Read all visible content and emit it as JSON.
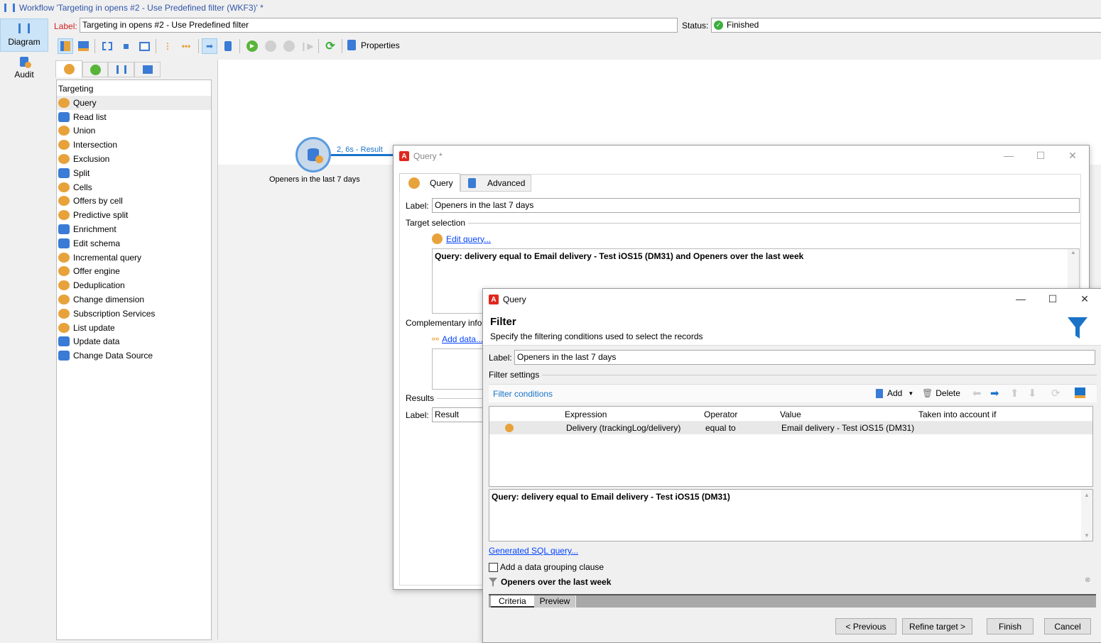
{
  "window": {
    "title": "Workflow 'Targeting in opens #2 - Use Predefined filter (WKF3)' *"
  },
  "nav": [
    {
      "label": "Diagram",
      "icon": "diagram-icon"
    },
    {
      "label": "Audit",
      "icon": "audit-icon"
    }
  ],
  "header": {
    "label_caption": "Label:",
    "label_value": "Targeting in opens #2 - Use Predefined filter",
    "status_caption": "Status:",
    "status_value": "Finished"
  },
  "toolbar": {
    "properties_label": "Properties"
  },
  "palette": {
    "category": "Targeting",
    "items": [
      "Query",
      "Read list",
      "Union",
      "Intersection",
      "Exclusion",
      "Split",
      "Cells",
      "Offers by cell",
      "Predictive split",
      "Enrichment",
      "Edit schema",
      "Incremental query",
      "Offer engine",
      "Deduplication",
      "Change dimension",
      "Subscription Services",
      "List update",
      "Update data",
      "Change Data Source"
    ]
  },
  "canvas": {
    "node_label": "Openers in the last 7 days",
    "transition_label": "2, 6s - Result"
  },
  "query_dialog": {
    "title": "Query *",
    "tabs": [
      "Query",
      "Advanced"
    ],
    "label_caption": "Label:",
    "label_value": "Openers in the last 7 days",
    "target_selection": "Target selection",
    "edit_query": "Edit query...",
    "query_text": "Query: delivery equal to Email delivery - Test iOS15 (DM31) and Openers over the last week",
    "complementary": "Complementary info",
    "add_data": "Add data...",
    "results": "Results",
    "result_label_caption": "Label:",
    "result_label_value": "Result"
  },
  "filter_dialog": {
    "title": "Query",
    "heading": "Filter",
    "subtitle": "Specify the filtering conditions used to select the records",
    "label_caption": "Label:",
    "label_value": "Openers in the last 7 days",
    "filter_settings": "Filter settings",
    "filter_conditions": "Filter conditions",
    "add": "Add",
    "delete": "Delete",
    "columns": [
      "Expression",
      "Operator",
      "Value",
      "Taken into account if"
    ],
    "rows": [
      {
        "expression": "Delivery (trackingLog/delivery)",
        "operator": "equal to",
        "value": "Email delivery - Test iOS15 (DM31)",
        "condition": ""
      }
    ],
    "query_text": "Query: delivery equal to Email delivery - Test iOS15 (DM31)",
    "generated_sql": "Generated SQL query...",
    "grouping": "Add a data grouping clause",
    "grouping_checked": false,
    "predefined_filter": "Openers over the last week",
    "subtabs": [
      "Criteria",
      "Preview"
    ],
    "buttons": {
      "previous": "< Previous",
      "refine": "Refine target >",
      "finish": "Finish",
      "cancel": "Cancel"
    }
  },
  "colors": {
    "accent": "#1a73c9",
    "orange": "#e8a23b",
    "label_red": "#d42020",
    "link": "#0645ff"
  }
}
